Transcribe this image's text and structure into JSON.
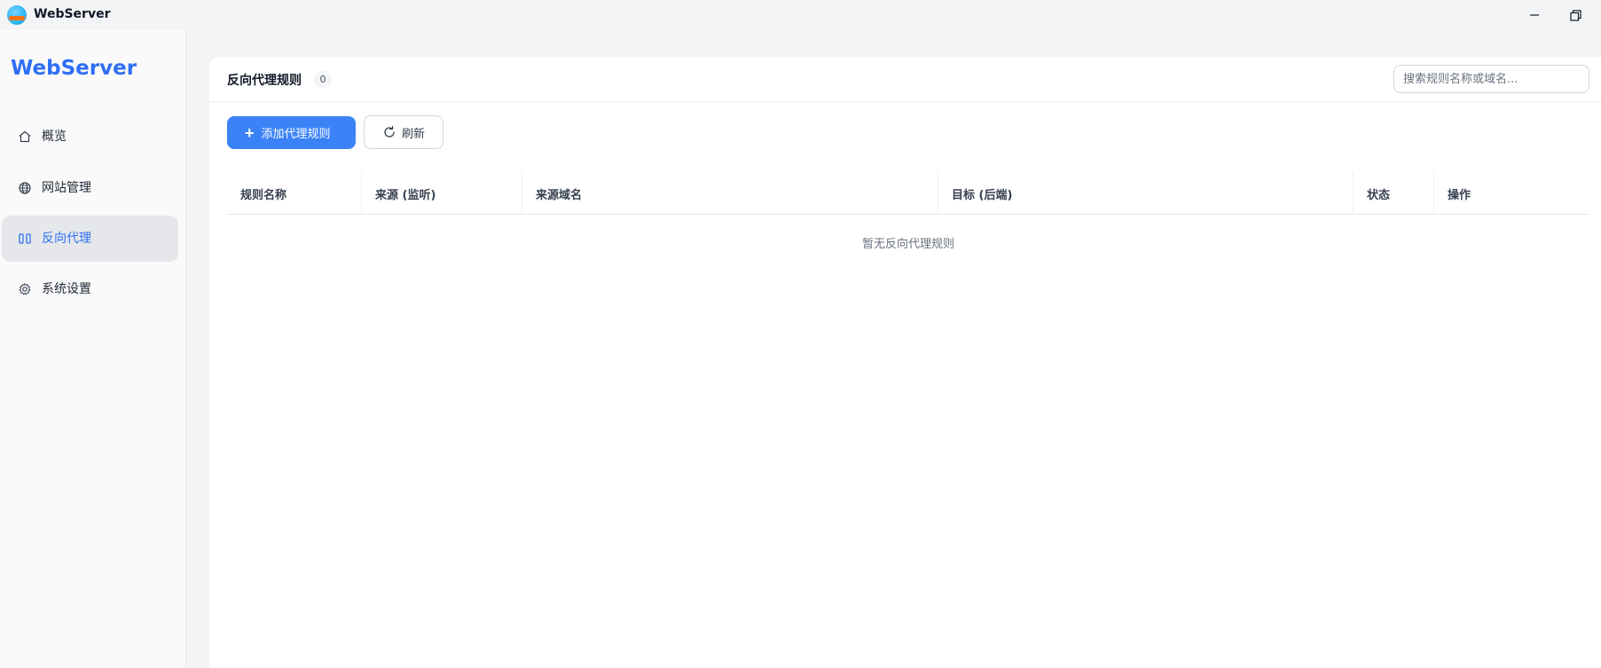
{
  "window": {
    "title": "WebServer"
  },
  "sidebar": {
    "brand": "WebServer",
    "items": [
      {
        "label": "概览",
        "icon": "home-icon",
        "active": false
      },
      {
        "label": "网站管理",
        "icon": "globe-icon",
        "active": false
      },
      {
        "label": "反向代理",
        "icon": "proxy-icon",
        "active": true
      },
      {
        "label": "系统设置",
        "icon": "gear-icon",
        "active": false
      }
    ]
  },
  "main": {
    "title": "反向代理规则",
    "count": "0",
    "search": {
      "placeholder": "搜索规则名称或域名...",
      "value": ""
    },
    "toolbar": {
      "add_label": "添加代理规则",
      "refresh_label": "刷新"
    },
    "table": {
      "columns": [
        "规则名称",
        "来源 (监听)",
        "来源域名",
        "目标 (后端)",
        "状态",
        "操作"
      ],
      "rows": [],
      "empty_text": "暂无反向代理规则"
    }
  },
  "colors": {
    "accent": "#2f6ff5",
    "primary_button": "#3b82f6"
  }
}
